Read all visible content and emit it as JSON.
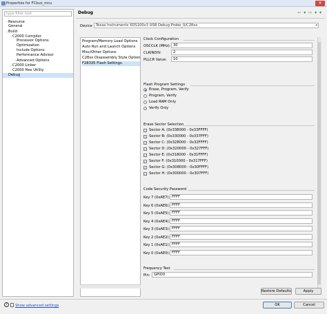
{
  "window": {
    "title": "Properties for FCbus_mcu",
    "close_glyph": "✕"
  },
  "filter": {
    "placeholder": "type filter text"
  },
  "tree": [
    {
      "label": "Resource",
      "twisty": "›"
    },
    {
      "label": "General",
      "twisty": ""
    },
    {
      "label": "Build",
      "twisty": "⌄"
    },
    {
      "label": "C2000 Compiler",
      "twisty": "⌄"
    },
    {
      "label": "Processor Options",
      "twisty": ""
    },
    {
      "label": "Optimization",
      "twisty": ""
    },
    {
      "label": "Include Options",
      "twisty": ""
    },
    {
      "label": "Performance Advisor",
      "twisty": ""
    },
    {
      "label": "Advanced Options",
      "twisty": "›"
    },
    {
      "label": "C2000 Linker",
      "twisty": "›"
    },
    {
      "label": "C2000 Hex Utility",
      "twisty": "›"
    },
    {
      "label": "Debug",
      "twisty": ""
    }
  ],
  "header": {
    "title": "Debug",
    "nav_glyphs": "⇦ ▾ ⇨ ▾ ▾"
  },
  "device": {
    "label": "Device",
    "value": "Texas Instruments XDS100v1 USB Debug Probe_0/C28xx"
  },
  "categories": [
    "Program/Memory Load Options",
    "Auto Run and Launch Options",
    "Misc/Other Options",
    "C28xx Disassembly Style Options",
    "F28335 Flash Settings"
  ],
  "clock": {
    "title": "Clock Configuration",
    "fields": [
      {
        "label": "OSCCLK (MHz):",
        "value": "30"
      },
      {
        "label": "CLKINDIV:",
        "value": "2"
      },
      {
        "label": "PLLCR Value:",
        "value": "10"
      }
    ]
  },
  "flash_program": {
    "title": "Flash Program Settings",
    "options": [
      {
        "label": "Erase, Program, Verify",
        "selected": true
      },
      {
        "label": "Program, Verify",
        "selected": false
      },
      {
        "label": "Load RAM Only",
        "selected": false
      },
      {
        "label": "Verify Only",
        "selected": false
      }
    ]
  },
  "erase_sector": {
    "title": "Erase Sector Selection",
    "sectors": [
      {
        "label": "Sector A: (0x338000 - 0x33FFFF)",
        "checked": true
      },
      {
        "label": "Sector B: (0x330000 - 0x337FFF)",
        "checked": true
      },
      {
        "label": "Sector C: (0x328000 - 0x32FFFF)",
        "checked": true
      },
      {
        "label": "Sector D: (0x320000 - 0x327FFF)",
        "checked": true
      },
      {
        "label": "Sector E: (0x318000 - 0x31FFFF)",
        "checked": true
      },
      {
        "label": "Sector F: (0x310000 - 0x317FFF)",
        "checked": true
      },
      {
        "label": "Sector G: (0x308000 - 0x30FFFF)",
        "checked": true
      },
      {
        "label": "Sector H: (0x300000 - 0x307FFF)",
        "checked": true
      }
    ]
  },
  "security": {
    "title": "Code Security Password",
    "keys": [
      {
        "label": "Key 7 (0xAE7):",
        "value": "FFFF"
      },
      {
        "label": "Key 6 (0xAE6):",
        "value": "FFFF"
      },
      {
        "label": "Key 5 (0xAE5):",
        "value": "FFFF"
      },
      {
        "label": "Key 4 (0xAE4):",
        "value": "FFFF"
      },
      {
        "label": "Key 3 (0xAE3):",
        "value": "FFFF"
      },
      {
        "label": "Key 2 (0xAE2):",
        "value": "FFFF"
      },
      {
        "label": "Key 1 (0xAE1):",
        "value": "FFFF"
      },
      {
        "label": "Key 0 (0xAE0):",
        "value": "FFFF"
      }
    ]
  },
  "frequency": {
    "title": "Frequency Test",
    "pin_label": "Pin:",
    "pin_value": "GPIO0"
  },
  "buttons": {
    "restore": "Restore Defaults",
    "apply": "Apply",
    "ok": "OK",
    "cancel": "Cancel"
  },
  "footer": {
    "help_glyph": "?",
    "advanced_link": "Show advanced settings"
  }
}
